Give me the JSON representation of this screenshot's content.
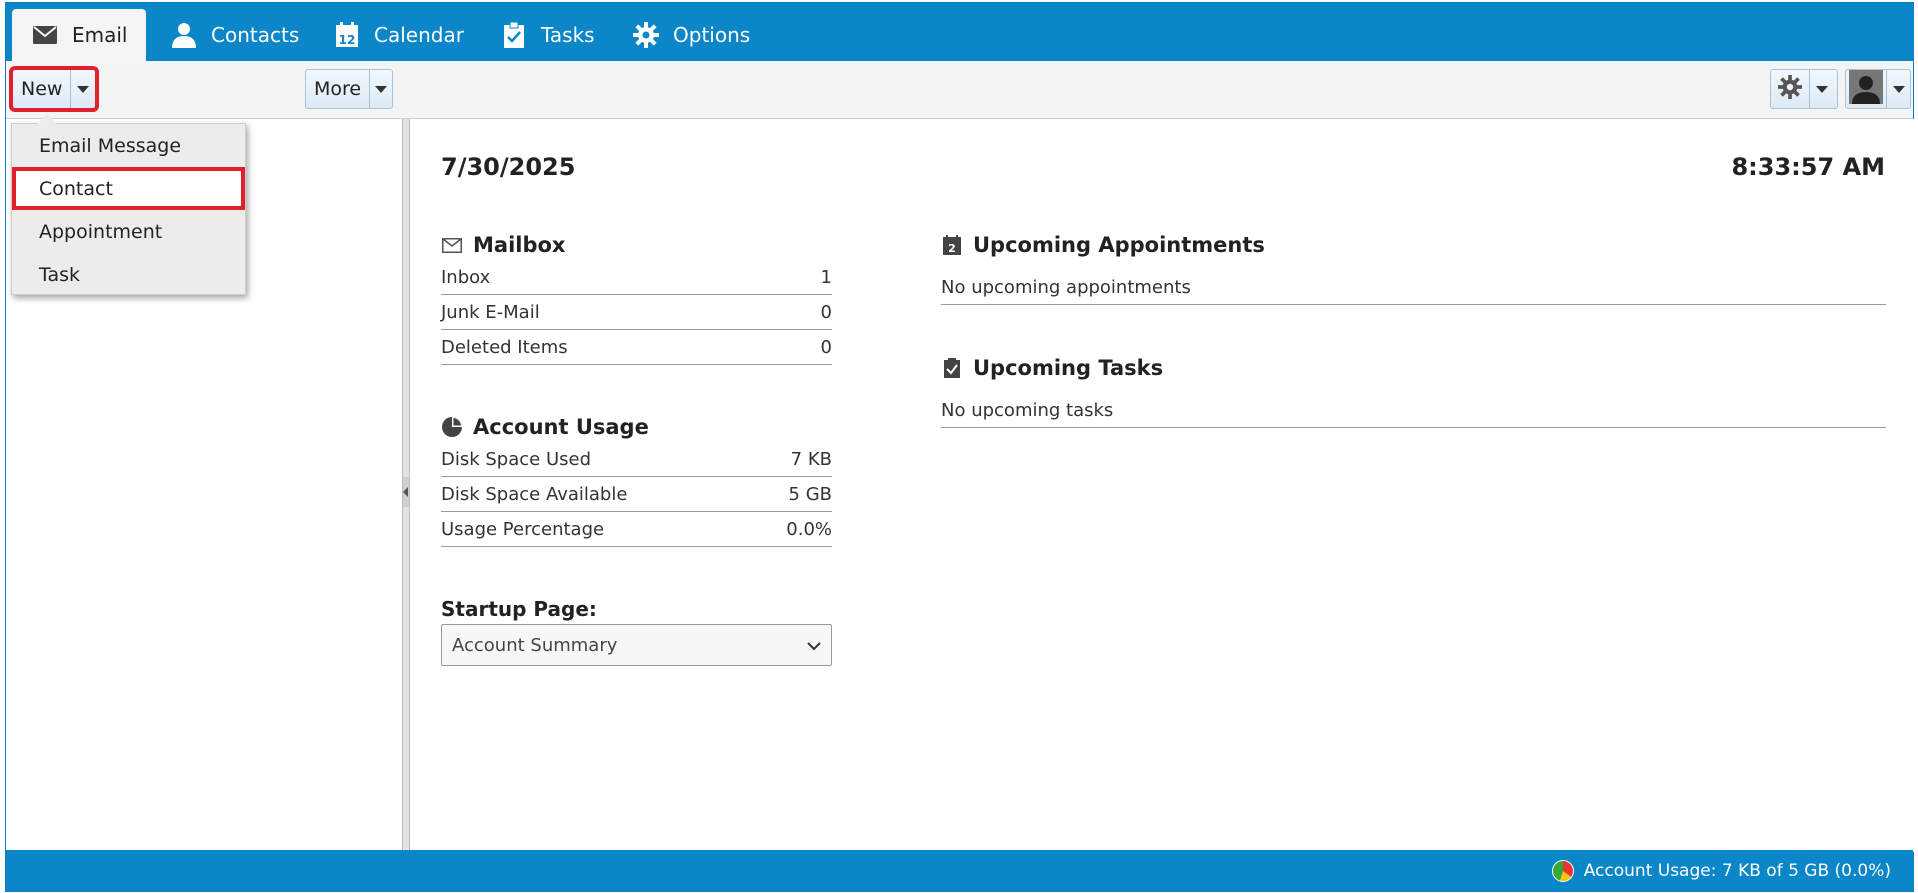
{
  "tabs": [
    {
      "label": "Email",
      "icon": "envelope-icon",
      "active": true
    },
    {
      "label": "Contacts",
      "icon": "person-icon"
    },
    {
      "label": "Calendar",
      "icon": "calendar-icon"
    },
    {
      "label": "Tasks",
      "icon": "clipboard-check-icon"
    },
    {
      "label": "Options",
      "icon": "gear-icon"
    }
  ],
  "toolbar": {
    "new_label": "New",
    "more_label": "More"
  },
  "new_menu": {
    "items": [
      "Email Message",
      "Contact",
      "Appointment",
      "Task"
    ],
    "selected": "Contact"
  },
  "summary": {
    "date": "7/30/2025",
    "time": "8:33:57 AM",
    "mailbox": {
      "title": "Mailbox",
      "rows": [
        {
          "label": "Inbox",
          "value": "1"
        },
        {
          "label": "Junk E-Mail",
          "value": "0"
        },
        {
          "label": "Deleted Items",
          "value": "0"
        }
      ]
    },
    "account_usage": {
      "title": "Account Usage",
      "rows": [
        {
          "label": "Disk Space Used",
          "value": "7 KB"
        },
        {
          "label": "Disk Space Available",
          "value": "5 GB"
        },
        {
          "label": "Usage Percentage",
          "value": "0.0%"
        }
      ]
    },
    "startup": {
      "label": "Startup Page:",
      "selected": "Account Summary"
    },
    "appointments": {
      "title": "Upcoming Appointments",
      "empty": "No upcoming appointments"
    },
    "tasks": {
      "title": "Upcoming Tasks",
      "empty": "No upcoming tasks"
    }
  },
  "status": {
    "text": "Account Usage: 7 KB of 5 GB (0.0%)"
  },
  "colors": {
    "brand": "#0a86c9",
    "highlight": "#e0202a"
  }
}
